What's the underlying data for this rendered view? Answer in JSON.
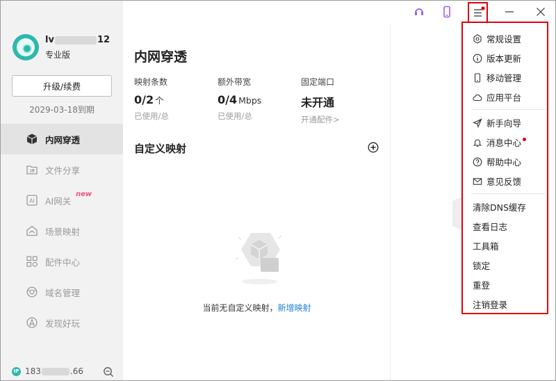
{
  "sidebar": {
    "username_prefix": "lv",
    "username_suffix": "12",
    "edition": "专业版",
    "upgrade_label": "升级/续费",
    "expire_text": "2029-03-18到期",
    "items": [
      {
        "label": "内网穿透",
        "icon": "cube-icon"
      },
      {
        "label": "文件分享",
        "icon": "folder-share-icon"
      },
      {
        "label": "AI网关",
        "icon": "ai-icon",
        "badge": "new"
      },
      {
        "label": "场景映射",
        "icon": "house-icon"
      },
      {
        "label": "配件中心",
        "icon": "grid-icon"
      },
      {
        "label": "域名管理",
        "icon": "globe-icon"
      },
      {
        "label": "发现好玩",
        "icon": "compass-icon"
      }
    ],
    "ip_prefix": "183",
    "ip_suffix": ".66",
    "ip_badge": "IP"
  },
  "main": {
    "title": "内网穿透",
    "stats": [
      {
        "label": "映射条数",
        "value": "0/2",
        "unit": "个",
        "sub": "已使用/总"
      },
      {
        "label": "额外带宽",
        "value": "0/4",
        "unit": "Mbps",
        "sub": "已使用/总"
      },
      {
        "label": "固定端口",
        "value": "未开通",
        "unit": "",
        "sub": "开通配件>"
      }
    ],
    "section_title": "自定义映射",
    "empty_text": "当前无自定义映射，",
    "empty_link": "新增映射"
  },
  "menu": {
    "group1": [
      {
        "label": "常规设置",
        "icon": "gear-icon"
      },
      {
        "label": "版本更新",
        "icon": "info-icon"
      },
      {
        "label": "移动管理",
        "icon": "phone-icon"
      },
      {
        "label": "应用平台",
        "icon": "cloud-icon"
      }
    ],
    "group2": [
      {
        "label": "新手向导",
        "icon": "send-icon"
      },
      {
        "label": "消息中心",
        "icon": "bell-icon",
        "dot": true
      },
      {
        "label": "帮助中心",
        "icon": "help-icon"
      },
      {
        "label": "意见反馈",
        "icon": "mail-icon"
      }
    ],
    "group3": [
      {
        "label": "清除DNS缓存"
      },
      {
        "label": "查看日志"
      },
      {
        "label": "工具箱"
      },
      {
        "label": "锁定"
      },
      {
        "label": "重登"
      },
      {
        "label": "注销登录"
      }
    ]
  },
  "colors": {
    "accent": "#2fb8ad",
    "highlight": "#e0000b",
    "link": "#1e7fd8",
    "titlebar_icon": "#9b5cf0"
  }
}
